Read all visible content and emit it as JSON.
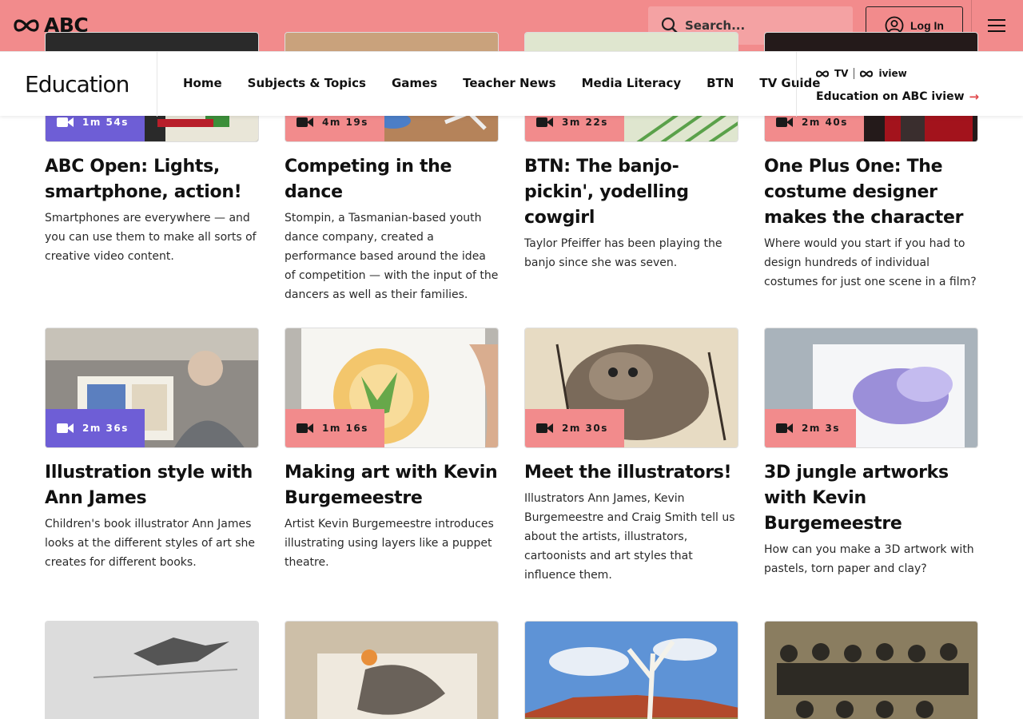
{
  "header": {
    "logo_text": "ABC",
    "search_placeholder": "Search...",
    "login_label": "Log In"
  },
  "nav": {
    "brand": "Education",
    "links": [
      "Home",
      "Subjects & Topics",
      "Games",
      "Teacher News",
      "Media Literacy",
      "BTN",
      "TV Guide"
    ],
    "iview_logo_tv": "TV",
    "iview_logo_iview": "iview",
    "iview_link": "Education on ABC iview"
  },
  "cards": [
    {
      "duration": "1m 54s",
      "title": "ABC Open: Lights, smartphone, action!",
      "desc": "Smartphones are everywhere — and you can use them to make all sorts of creative video content."
    },
    {
      "duration": "4m 19s",
      "title": "Competing in the dance",
      "desc": "Stompin, a Tasmanian-based youth dance company, created a performance based around the idea of competition — with the input of the dancers as well as their families."
    },
    {
      "duration": "3m 22s",
      "title": "BTN: The banjo-pickin', yodelling cowgirl",
      "desc": "Taylor Pfeiffer has been playing the banjo since she was seven."
    },
    {
      "duration": "2m 40s",
      "title": "One Plus One: The costume designer makes the character",
      "desc": "Where would you start if you had to design hundreds of individual costumes for just one scene in a film?"
    },
    {
      "duration": "2m 36s",
      "title": "Illustration style with Ann James",
      "desc": "Children's book illustrator Ann James looks at the different styles of art she creates for different books."
    },
    {
      "duration": "1m 16s",
      "title": "Making art with Kevin Burgemeestre",
      "desc": "Artist Kevin Burgemeestre introduces illustrating using layers like a puppet theatre."
    },
    {
      "duration": "2m 30s",
      "title": "Meet the illustrators!",
      "desc": "Illustrators Ann James, Kevin Burgemeestre and Craig Smith tell us about the artists, illustrators, cartoonists and art styles that influence them."
    },
    {
      "duration": "2m 3s",
      "title": "3D jungle artworks with Kevin Burgemeestre",
      "desc": "How can you make a 3D artwork with pastels, torn paper and clay?"
    }
  ]
}
